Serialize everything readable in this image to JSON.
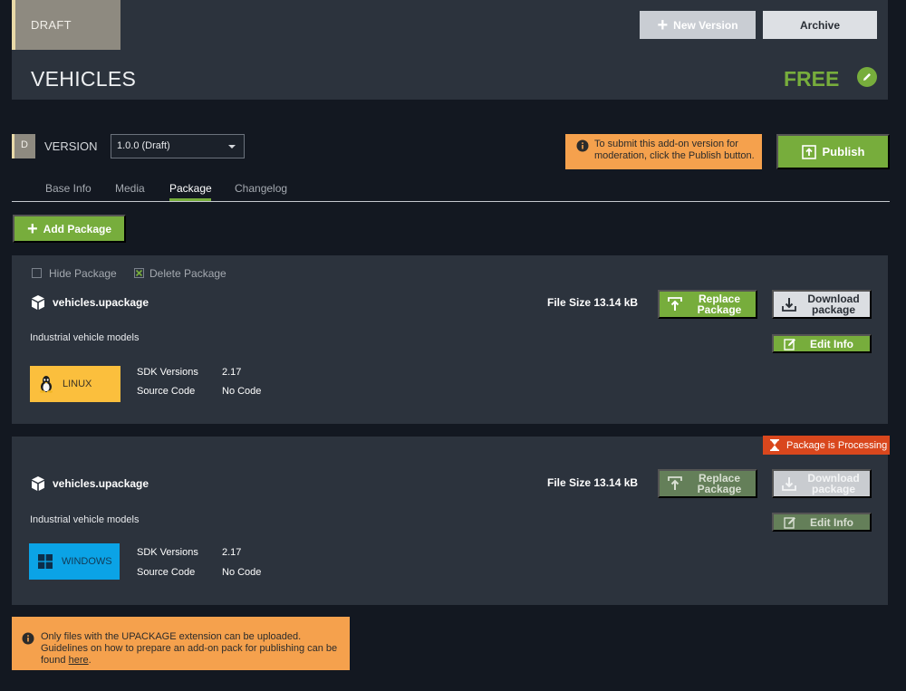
{
  "header": {
    "status_badge": "DRAFT",
    "new_version_label": "New Version",
    "archive_label": "Archive",
    "title": "VEHICLES",
    "price": "FREE"
  },
  "version": {
    "badge_letter": "D",
    "label": "VERSION",
    "selected": "1.0.0 (Draft)",
    "notice": "To submit this add-on version for moderation, click the Publish button.",
    "publish_label": "Publish"
  },
  "tabs": [
    {
      "label": "Base Info",
      "active": false
    },
    {
      "label": "Media",
      "active": false
    },
    {
      "label": "Package",
      "active": true
    },
    {
      "label": "Changelog",
      "active": false
    }
  ],
  "add_package_label": "Add Package",
  "packages": [
    {
      "hide_label": "Hide Package",
      "delete_label": "Delete Package",
      "name": "vehicles.upackage",
      "description": "Industrial vehicle models",
      "file_size": "File Size 13.14 kB",
      "replace_label": "Replace Package",
      "download_label": "Download package",
      "edit_label": "Edit Info",
      "platform": "LINUX",
      "sdk_key": "SDK Versions",
      "sdk_value": "2.17",
      "source_key": "Source Code",
      "source_value": "No Code"
    },
    {
      "status": "Package is Processing",
      "name": "vehicles.upackage",
      "description": "Industrial vehicle models",
      "file_size": "File Size 13.14 kB",
      "replace_label": "Replace Package",
      "download_label": "Download package",
      "edit_label": "Edit Info",
      "platform": "WINDOWS",
      "sdk_key": "SDK Versions",
      "sdk_value": "2.17",
      "source_key": "Source Code",
      "source_value": "No Code"
    }
  ],
  "footer_notice": {
    "text": "Only files with the UPACKAGE extension can be uploaded. Guidelines on how to prepare an add-on pack for publishing can be found",
    "link": "here",
    "suffix": "."
  },
  "colors": {
    "accent": "#77ad3c",
    "warning": "#f5a14d",
    "processing": "#d9471d",
    "card": "#2c333d",
    "background": "#131821"
  }
}
